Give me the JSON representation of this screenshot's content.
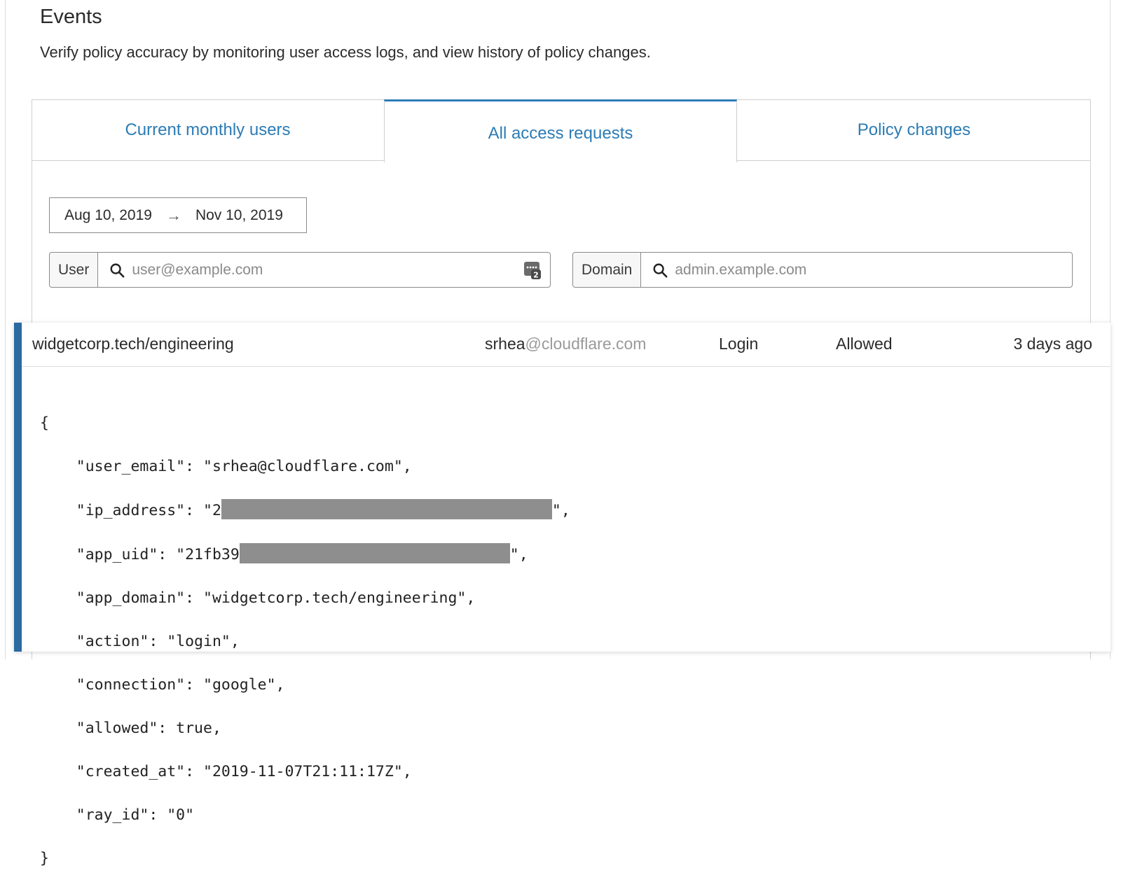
{
  "header": {
    "title": "Events",
    "description": "Verify policy accuracy by monitoring user access logs, and view history of policy changes."
  },
  "tabs": [
    {
      "label": "Current monthly users",
      "active": false
    },
    {
      "label": "All access requests",
      "active": true
    },
    {
      "label": "Policy changes",
      "active": false
    }
  ],
  "date_range": {
    "start": "Aug 10, 2019",
    "arrow": "→",
    "end": "Nov 10, 2019"
  },
  "filters": {
    "user": {
      "label": "User",
      "placeholder": "user@example.com"
    },
    "domain": {
      "label": "Domain",
      "placeholder": "admin.example.com"
    }
  },
  "event": {
    "app_domain": "widgetcorp.tech/engineering",
    "email_user": "srhea",
    "email_domain": "@cloudflare.com",
    "action": "Login",
    "status": "Allowed",
    "time": "3 days ago"
  },
  "json_detail": {
    "open": "{",
    "close": "}",
    "lines": [
      {
        "pre": "    \"user_email\": \"srhea@cloudflare.com\",",
        "redact": false
      },
      {
        "pre": "    \"ip_address\": \"2",
        "redact": true,
        "post": "\","
      },
      {
        "pre": "    \"app_uid\": \"21fb39",
        "redact": true,
        "post": "\","
      },
      {
        "pre": "    \"app_domain\": \"widgetcorp.tech/engineering\",",
        "redact": false
      },
      {
        "pre": "    \"action\": \"login\",",
        "redact": false
      },
      {
        "pre": "    \"connection\": \"google\",",
        "redact": false
      },
      {
        "pre": "    \"allowed\": true,",
        "redact": false
      },
      {
        "pre": "    \"created_at\": \"2019-11-07T21:11:17Z\",",
        "redact": false
      },
      {
        "pre": "    \"ray_id\": \"0\"",
        "redact": false
      }
    ]
  },
  "colors": {
    "accent": "#2c7cb5",
    "event_bar": "#2c6aa0",
    "redaction": "#8e8e8e"
  }
}
